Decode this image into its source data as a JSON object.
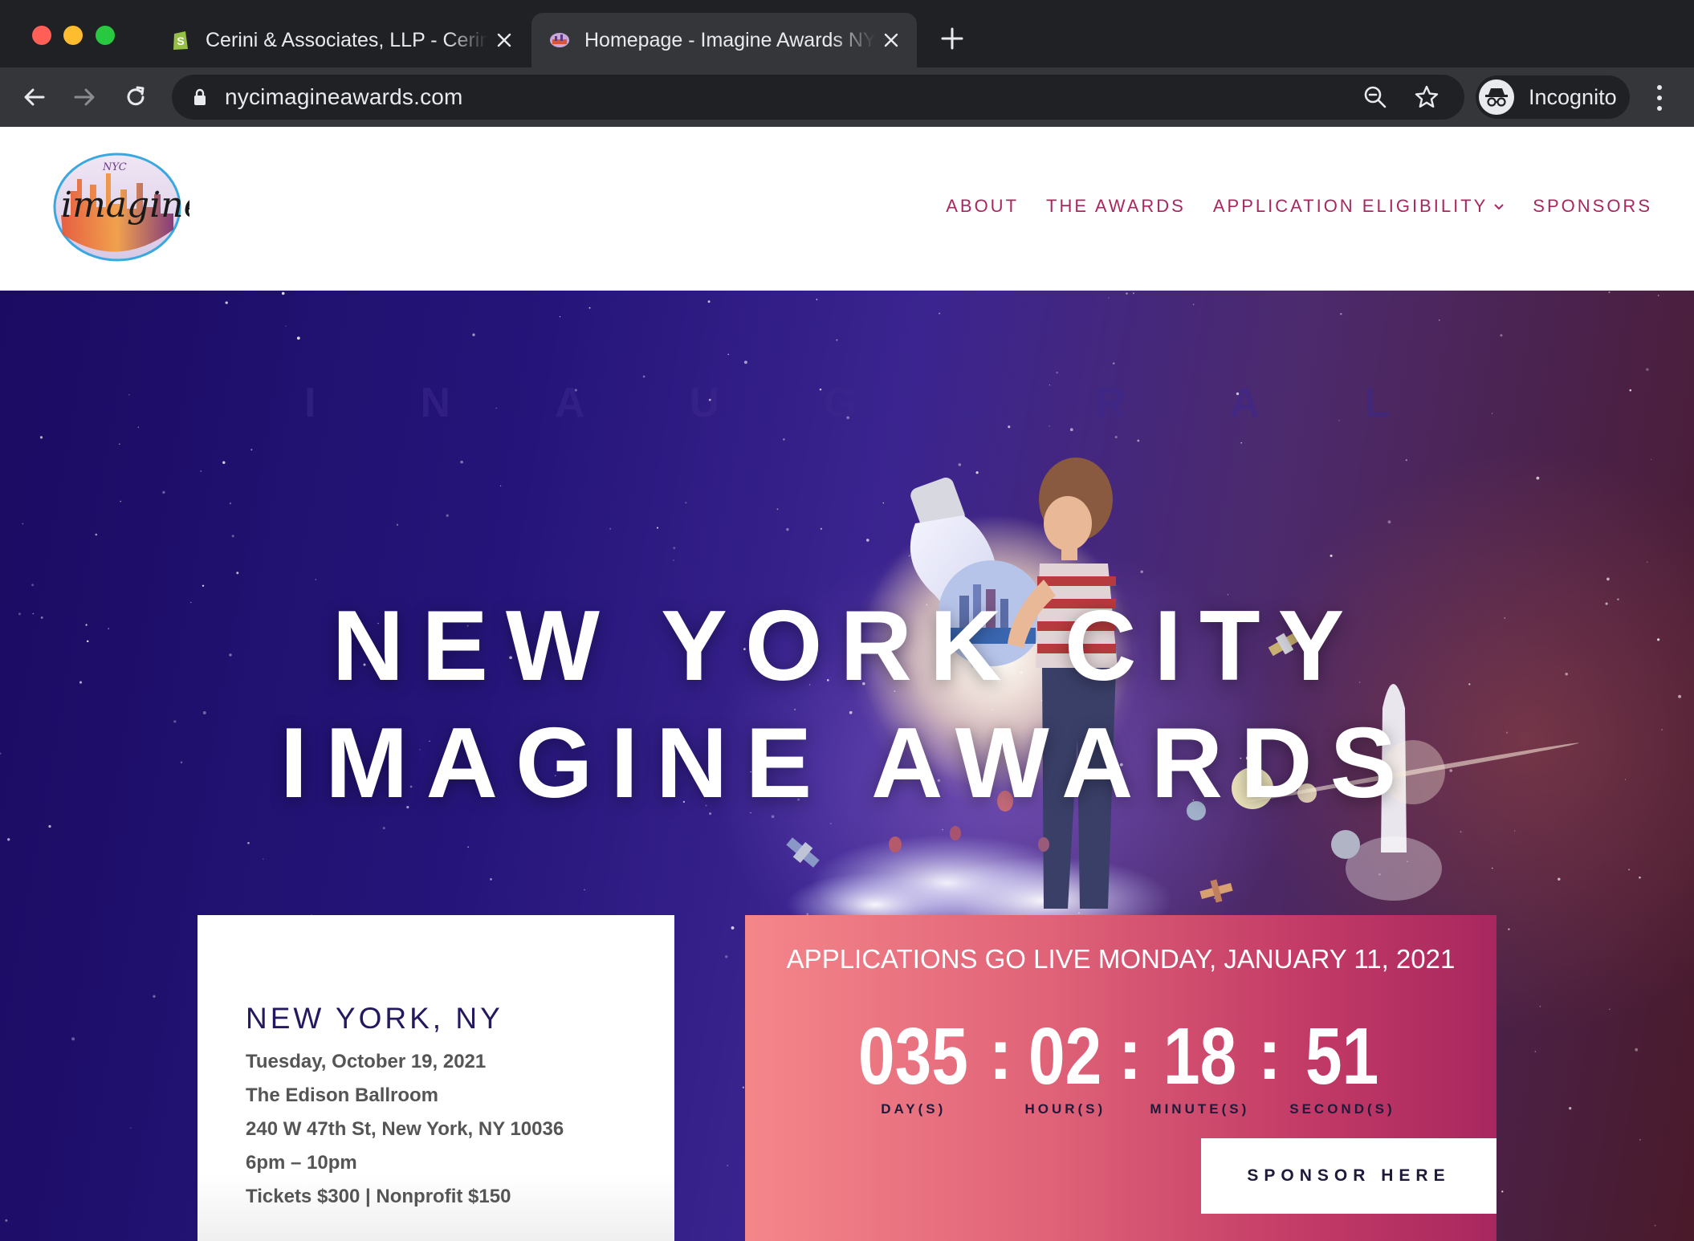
{
  "browser": {
    "tabs": [
      {
        "title": "Cerini & Associates, LLP - Cerini & Associates",
        "active": false
      },
      {
        "title": "Homepage - Imagine Awards NYC",
        "active": true
      }
    ],
    "url": "nycimagineawards.com",
    "profile_label": "Incognito"
  },
  "site": {
    "logo_text": "imagine",
    "logo_small": "NYC",
    "nav": [
      {
        "label": "ABOUT"
      },
      {
        "label": "THE AWARDS"
      },
      {
        "label": "APPLICATION ELIGIBILITY",
        "has_dropdown": true
      },
      {
        "label": "SPONSORS"
      }
    ]
  },
  "hero": {
    "eyebrow": "INAUGURAL",
    "title_line1": "NEW YORK CITY",
    "title_line2": "IMAGINE AWARDS"
  },
  "event": {
    "city": "NEW YORK, NY",
    "date": "Tuesday, October 19, 2021",
    "venue": "The Edison Ballroom",
    "address": "240 W 47th St, New York, NY 10036",
    "time": "6pm – 10pm",
    "tickets": "Tickets $300 | Nonprofit $150"
  },
  "countdown": {
    "heading": "APPLICATIONS GO LIVE MONDAY, JANUARY 11, 2021",
    "units": [
      {
        "value": "035",
        "label": "DAY(S)"
      },
      {
        "value": "02",
        "label": "HOUR(S)"
      },
      {
        "value": "18",
        "label": "MINUTE(S)"
      },
      {
        "value": "51",
        "label": "SECOND(S)"
      }
    ],
    "cta": "SPONSOR HERE"
  },
  "colors": {
    "brand_magenta": "#a8275f",
    "navy_text": "#24185e",
    "hero_indigo": "#25157a"
  }
}
